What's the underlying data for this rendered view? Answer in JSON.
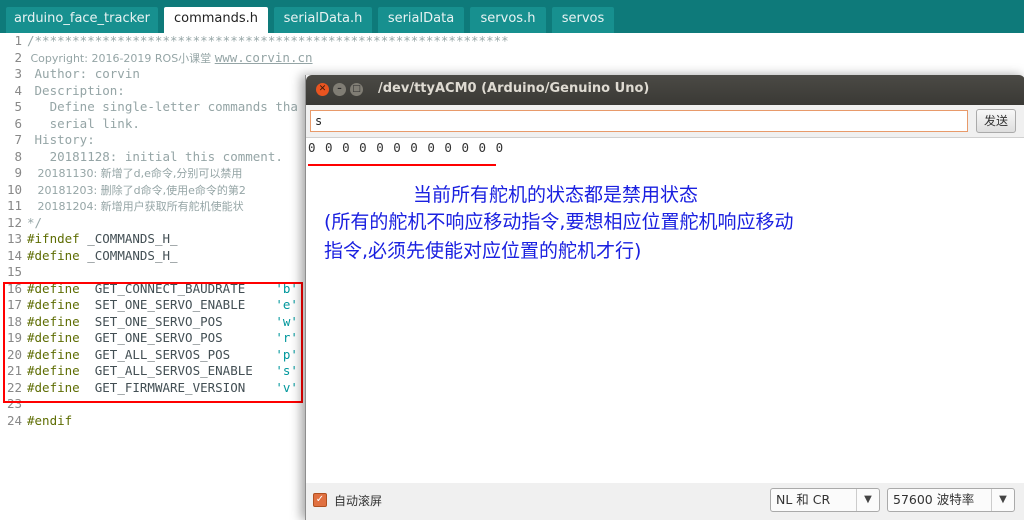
{
  "tabs": [
    {
      "label": "arduino_face_tracker",
      "active": false
    },
    {
      "label": "commands.h",
      "active": true
    },
    {
      "label": "serialData.h",
      "active": false
    },
    {
      "label": "serialData",
      "active": false
    },
    {
      "label": "servos.h",
      "active": false
    },
    {
      "label": "servos",
      "active": false
    }
  ],
  "editor": {
    "line_numbers": [
      "1",
      "2",
      "3",
      "4",
      "5",
      "6",
      "7",
      "8",
      "9",
      "10",
      "11",
      "12",
      "13",
      "14",
      "15",
      "16",
      "17",
      "18",
      "19",
      "20",
      "21",
      "22",
      "23",
      "24"
    ],
    "comment_block": {
      "top": "/***************************************************************",
      "copyright": " Copyright: 2016-2019 ROS小课堂 ",
      "url": "www.corvin.cn",
      "author": " Author: corvin",
      "description": " Description:",
      "desc1": "   Define single-letter commands tha",
      "desc2": "   serial link.",
      "history": " History:",
      "h1": "   20181128: initial this comment.",
      "h2": "   20181130: 新增了d,e命令,分别可以禁用",
      "h3": "   20181203: 删除了d命令,使用e命令的第2",
      "h4": "   20181204: 新增用户获取所有舵机使能状",
      "end": "*/"
    },
    "ifndef_kw": "#ifndef",
    "ifndef_name": " _COMMANDS_H_",
    "define_kw": "#define",
    "define_name": " _COMMANDS_H_",
    "endif_kw": "#endif",
    "defines": [
      {
        "kw": "#define",
        "name": "  GET_CONNECT_BAUDRATE    ",
        "val": "'b'"
      },
      {
        "kw": "#define",
        "name": "  SET_ONE_SERVO_ENABLE    ",
        "val": "'e'"
      },
      {
        "kw": "#define",
        "name": "  SET_ONE_SERVO_POS       ",
        "val": "'w'"
      },
      {
        "kw": "#define",
        "name": "  GET_ONE_SERVO_POS       ",
        "val": "'r'"
      },
      {
        "kw": "#define",
        "name": "  GET_ALL_SERVOS_POS      ",
        "val": "'p'"
      },
      {
        "kw": "#define",
        "name": "  GET_ALL_SERVOS_ENABLE   ",
        "val": "'s'"
      },
      {
        "kw": "#define",
        "name": "  GET_FIRMWARE_VERSION    ",
        "val": "'v'"
      }
    ]
  },
  "serial_monitor": {
    "title": "/dev/ttyACM0 (Arduino/Genuino Uno)",
    "input_value": "s",
    "send_label": "发送",
    "output": "0 0 0 0 0 0 0 0 0 0 0 0",
    "note_line1": "当前所有舵机的状态都是禁用状态",
    "note_line2": "(所有的舵机不响应移动指令,要想相应位置舵机响应移动",
    "note_line3": "指令,必须先使能对应位置的舵机才行)",
    "autoscroll_label": "自动滚屏",
    "autoscroll_checked": true,
    "line_ending": "NL 和 CR",
    "baud": "57600 波特率"
  },
  "colors": {
    "tabbar": "#0e7a7a",
    "annotation_blue": "#1a20e0",
    "highlight_red": "#ff0000",
    "keyword": "#5e6d03",
    "string": "#00979c",
    "comment": "#95a5a6"
  }
}
